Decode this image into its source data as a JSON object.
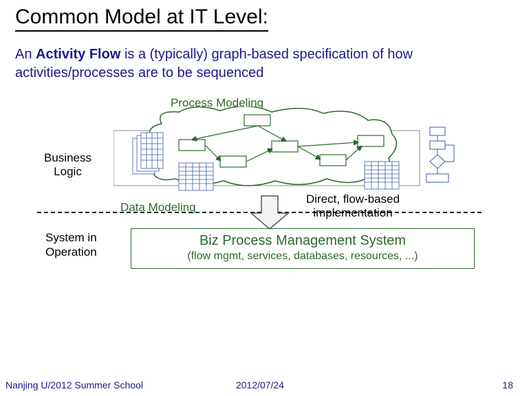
{
  "title": "Common Model at IT Level:",
  "subtitle_pre": "An ",
  "subtitle_term": "Activity Flow",
  "subtitle_post": " is a (typically) graph-based specification of how activities/processes are to be sequenced",
  "labels": {
    "process_modeling": "Process Modeling",
    "business_logic_1": "Business",
    "business_logic_2": "Logic",
    "data_modeling": "Data Modeling",
    "direct_1": "Direct, flow-based",
    "direct_2": "implementation",
    "system_1": "System in",
    "system_2": "Operation",
    "bpm_title": "Biz Process Management System",
    "bpm_sub": "(flow mgmt, services, databases, resources, ...)"
  },
  "footer": {
    "left": "Nanjing U/2012 Summer School",
    "center": "2012/07/24",
    "right": "18"
  }
}
